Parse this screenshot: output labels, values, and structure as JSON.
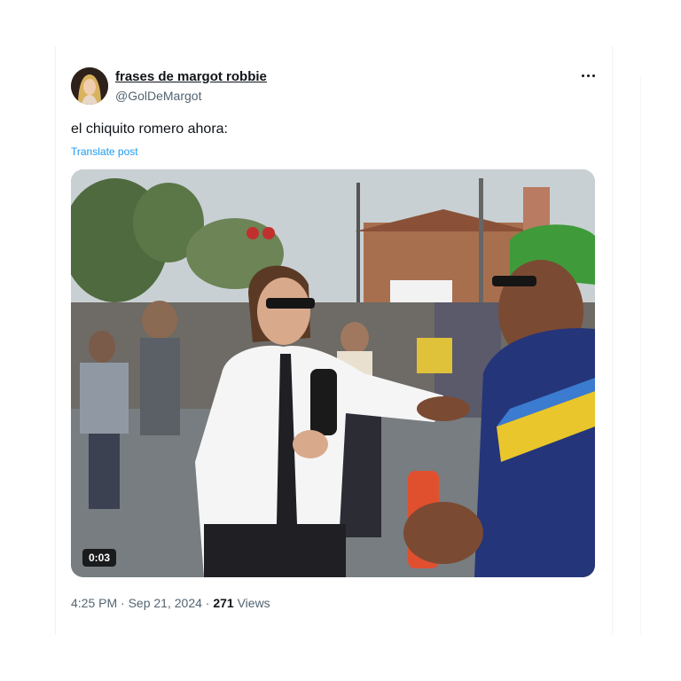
{
  "user": {
    "name": "frases de margot robbie",
    "handle": "@GolDeMargot",
    "avatar": "avatar-photo"
  },
  "post": {
    "text": "el chiquito romero ahora:",
    "translate_label": "Translate post"
  },
  "media": {
    "duration": "0:03",
    "kind": "video"
  },
  "meta": {
    "time": "4:25 PM",
    "separator": "·",
    "date": "Sep 21, 2024",
    "views_count": "271",
    "views_label": "Views"
  },
  "icons": {
    "more": "more-horizontal-icon"
  },
  "colors": {
    "link": "#1d9bf0",
    "text": "#0f1419",
    "secondary": "#536471"
  }
}
